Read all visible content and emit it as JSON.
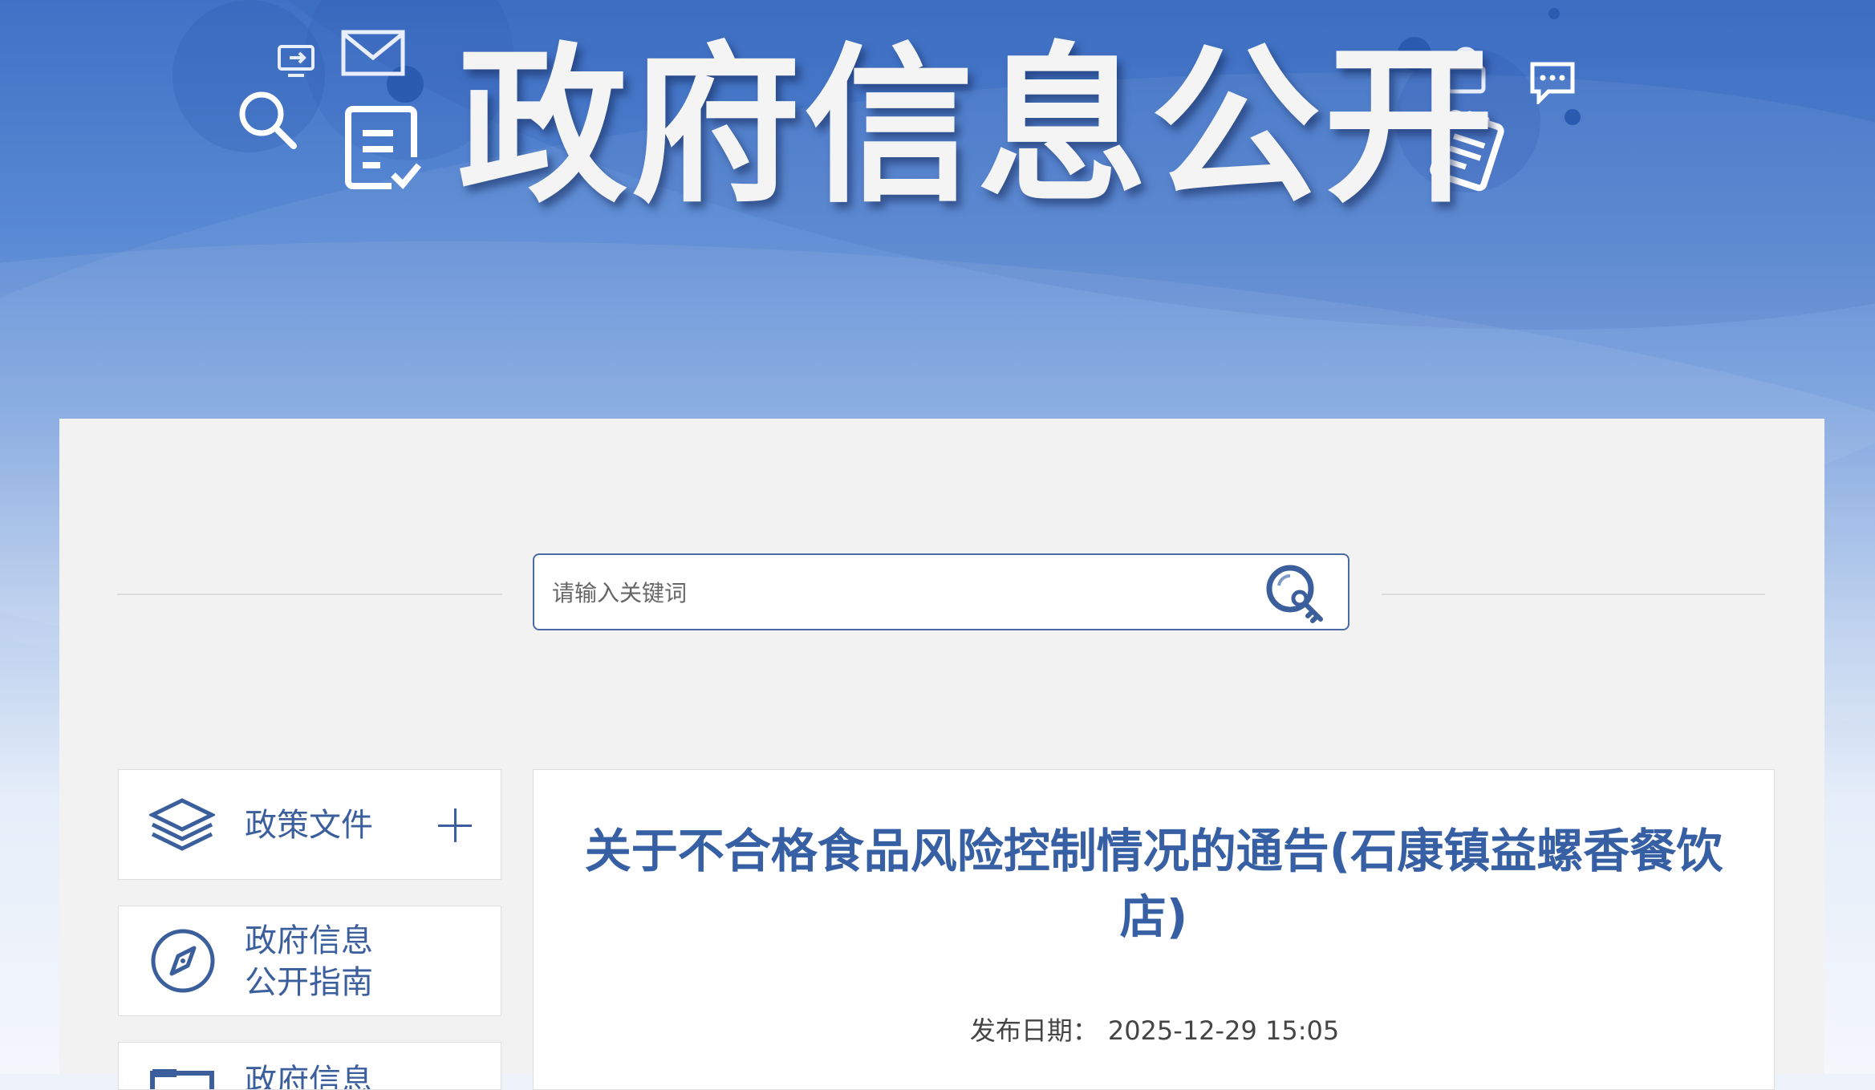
{
  "banner": {
    "title": "政府信息公开",
    "icons": [
      "screen-share-icon",
      "mail-icon",
      "search-icon",
      "document-check-icon",
      "lock-icon",
      "chat-icon",
      "clipboard-icon"
    ]
  },
  "search": {
    "placeholder": "请输入关键词",
    "button_icon": "search-key-icon"
  },
  "sidebar": {
    "items": [
      {
        "label": "政策文件",
        "icon": "layers-icon",
        "expandable": true
      },
      {
        "label": "政府信息\n公开指南",
        "icon": "compass-icon",
        "expandable": false
      },
      {
        "label": "政府信息",
        "icon": "folder-icon",
        "expandable": false
      }
    ]
  },
  "article": {
    "title": "关于不合格食品风险控制情况的通告(石康镇益螺香餐饮店)",
    "publish_label": "发布日期：",
    "publish_date": "2025-12-29 15:05"
  },
  "colors": {
    "banner_blue": "#3f72c6",
    "accent": "#3b5f9c",
    "title_blue": "#3760a4",
    "panel_bg": "#f2f2f2"
  }
}
